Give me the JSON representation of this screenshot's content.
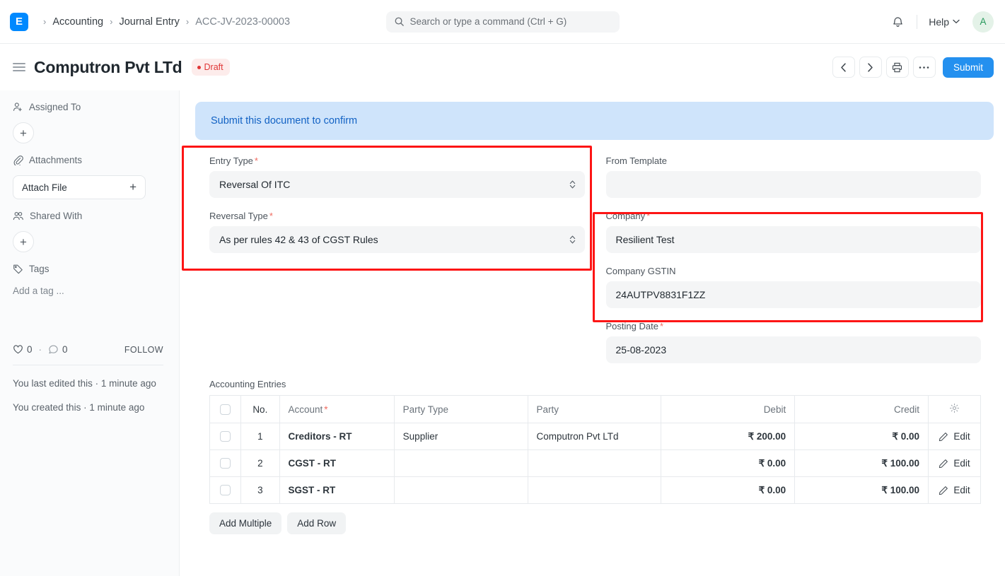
{
  "navbar": {
    "logo_text": "E",
    "breadcrumb": [
      {
        "label": "Accounting"
      },
      {
        "label": "Journal Entry"
      },
      {
        "label": "ACC-JV-2023-00003"
      }
    ],
    "search_placeholder": "Search or type a command (Ctrl + G)",
    "search_value": "",
    "help_label": "Help",
    "avatar_initial": "A"
  },
  "page_head": {
    "title": "Computron Pvt LTd",
    "status": "Draft",
    "submit_label": "Submit"
  },
  "sidebar": {
    "assigned_to_label": "Assigned To",
    "assigned_add": "+",
    "attachments_label": "Attachments",
    "attach_file_label": "Attach File",
    "attach_plus": "+",
    "shared_with_label": "Shared With",
    "shared_add": "+",
    "tags_label": "Tags",
    "tag_placeholder": "Add a tag ...",
    "likes_count": "0",
    "comments_count": "0",
    "separator": "·",
    "follow_label": "FOLLOW",
    "last_edited": "You last edited this · 1 minute ago",
    "created": "You created this · 1 minute ago"
  },
  "main": {
    "alert_text": "Submit this document to confirm",
    "fields": {
      "entry_type": {
        "label": "Entry Type",
        "required": "*",
        "value": "Reversal Of ITC"
      },
      "reversal_type": {
        "label": "Reversal Type",
        "required": "*",
        "value": "As per rules 42 & 43 of CGST Rules"
      },
      "from_template": {
        "label": "From Template",
        "value": ""
      },
      "company": {
        "label": "Company",
        "required": "*",
        "value": "Resilient Test"
      },
      "company_gstin": {
        "label": "Company GSTIN",
        "value": "24AUTPV8831F1ZZ"
      },
      "posting_date": {
        "label": "Posting Date",
        "required": "*",
        "value": "25-08-2023"
      }
    },
    "table": {
      "title": "Accounting Entries",
      "columns": {
        "no": "No.",
        "account": "Account",
        "account_required": "*",
        "party_type": "Party Type",
        "party": "Party",
        "debit": "Debit",
        "credit": "Credit"
      },
      "rows": [
        {
          "no": "1",
          "account": "Creditors - RT",
          "party_type": "Supplier",
          "party": "Computron Pvt LTd",
          "debit": "₹ 200.00",
          "credit": "₹ 0.00",
          "edit": "Edit"
        },
        {
          "no": "2",
          "account": "CGST - RT",
          "party_type": "",
          "party": "",
          "debit": "₹ 0.00",
          "credit": "₹ 100.00",
          "edit": "Edit"
        },
        {
          "no": "3",
          "account": "SGST - RT",
          "party_type": "",
          "party": "",
          "debit": "₹ 0.00",
          "credit": "₹ 100.00",
          "edit": "Edit"
        }
      ],
      "add_multiple_label": "Add Multiple",
      "add_row_label": "Add Row"
    }
  },
  "colors": {
    "brand": "#0089ff",
    "primary_button": "#2490ef",
    "alert_bg": "#cfe4fb",
    "alert_text": "#1262c4",
    "status_red": "#e03636",
    "highlight_red": "#fd1515",
    "avatar_bg": "#e4f2e8",
    "avatar_text": "#28995c"
  }
}
